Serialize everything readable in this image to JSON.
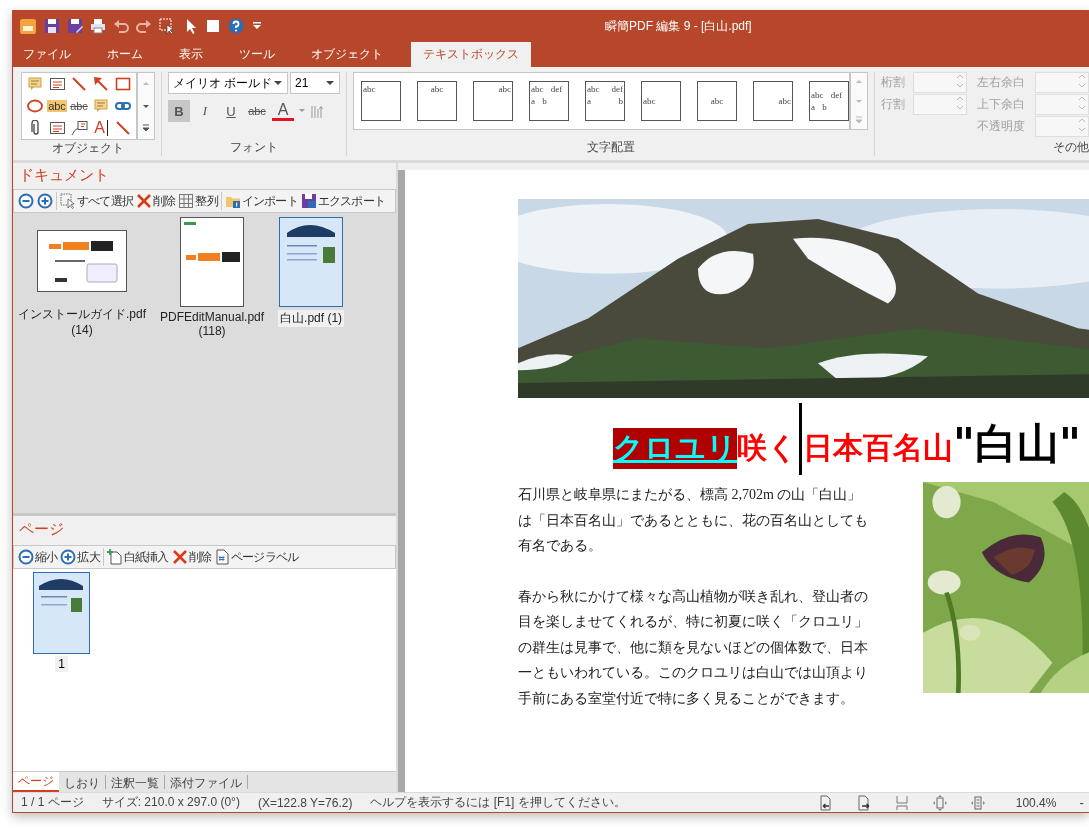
{
  "window": {
    "title": "瞬簡PDF 編集 9 - [白山.pdf]"
  },
  "tabs": [
    {
      "label": "ファイル",
      "selected": false
    },
    {
      "label": "ホーム",
      "selected": false
    },
    {
      "label": "表示",
      "selected": false
    },
    {
      "label": "ツール",
      "selected": false
    },
    {
      "label": "オブジェクト",
      "selected": false
    },
    {
      "label": "テキストボックス",
      "selected": true
    }
  ],
  "ribbon": {
    "object_group": {
      "label": "オブジェクト",
      "tools": [
        {
          "kind": "note"
        },
        {
          "kind": "textbox"
        },
        {
          "kind": "line"
        },
        {
          "kind": "arrow"
        },
        {
          "kind": "rect"
        },
        {
          "kind": "ellipse"
        },
        {
          "kind": "highlight",
          "label": "abc"
        },
        {
          "kind": "strikeout",
          "label": "abc"
        },
        {
          "kind": "note"
        },
        {
          "kind": "link"
        },
        {
          "kind": "clip"
        },
        {
          "kind": "textbox"
        },
        {
          "kind": "callout"
        },
        {
          "kind": "text",
          "label": "A"
        },
        {
          "kind": "line"
        }
      ]
    },
    "font_group": {
      "label": "フォント",
      "font_name": "メイリオ ボールド",
      "font_size": "21",
      "buttons": [
        {
          "kind": "bold",
          "label": "B",
          "selected": true
        },
        {
          "kind": "italic",
          "label": "I",
          "selected": false
        },
        {
          "kind": "underline",
          "label": "U",
          "selected": false
        },
        {
          "kind": "strike",
          "label": "abc",
          "selected": false
        },
        {
          "kind": "color",
          "label": "A",
          "color": "#e81123"
        }
      ]
    },
    "align_group": {
      "label": "文字配置",
      "items": [
        {
          "kind": "top-left",
          "lines": [
            "abc"
          ]
        },
        {
          "kind": "top-center",
          "lines": [
            "abc"
          ]
        },
        {
          "kind": "top-right",
          "lines": [
            "abc"
          ]
        },
        {
          "kind": "top-justify",
          "lines": [
            "abc def",
            "a b"
          ]
        },
        {
          "kind": "top-distribute",
          "lines": [
            "abc def",
            "a b"
          ]
        },
        {
          "kind": "middle-left",
          "lines": [
            "abc"
          ]
        },
        {
          "kind": "middle-center",
          "lines": [
            "abc"
          ]
        },
        {
          "kind": "middle-right",
          "lines": [
            "abc"
          ]
        },
        {
          "kind": "middle-justify",
          "lines": [
            "abc def",
            "a b"
          ]
        }
      ]
    },
    "other_group": {
      "label": "その他",
      "left_fields": [
        {
          "label": "桁割",
          "disabled": true
        },
        {
          "label": "行割",
          "disabled": true
        }
      ],
      "right_fields": [
        {
          "label": "左右余白",
          "disabled": true
        },
        {
          "label": "上下余白",
          "disabled": true
        },
        {
          "label": "不透明度",
          "disabled": true
        }
      ]
    }
  },
  "documents": {
    "title": "ドキュメント",
    "toolbar": [
      {
        "buttons": [
          {
            "kind": "zoom-out"
          },
          {
            "kind": "zoom-in"
          }
        ]
      },
      {
        "buttons": [
          {
            "kind": "select-all",
            "label": "すべて選択"
          },
          {
            "kind": "delete",
            "label": "削除"
          },
          {
            "kind": "arrange",
            "label": "整列"
          }
        ]
      },
      {
        "buttons": [
          {
            "kind": "import",
            "label": "インポート"
          },
          {
            "kind": "export",
            "label": "エクスポート"
          }
        ]
      }
    ],
    "files": [
      {
        "name": "インストールガイド.pdf",
        "count": "(14)",
        "kind": "landscape",
        "selected": false
      },
      {
        "name": "PDFEditManual.pdf",
        "count": "(118)",
        "kind": "portrait",
        "selected": false
      },
      {
        "name": "白山.pdf (1)",
        "selected": true
      }
    ]
  },
  "pages": {
    "title": "ページ",
    "toolbar": [
      {
        "buttons": [
          {
            "kind": "zoom-out",
            "label": "縮小"
          },
          {
            "kind": "zoom-in",
            "label": "拡大"
          }
        ]
      },
      {
        "buttons": [
          {
            "kind": "blank-page",
            "label": "白紙挿入"
          },
          {
            "kind": "delete",
            "label": "削除"
          },
          {
            "kind": "page-label",
            "label": "ページラベル"
          }
        ]
      }
    ],
    "items": [
      {
        "label": "1",
        "selected": true
      }
    ]
  },
  "panel_tabs": [
    {
      "label": "ページ",
      "selected": true
    },
    {
      "label": "しおり",
      "selected": false
    },
    {
      "label": "注釈一覧",
      "selected": false
    },
    {
      "label": "添付ファイル",
      "selected": false
    }
  ],
  "document": {
    "heading": [
      {
        "text": "クロユリ",
        "kind": "selected"
      },
      {
        "text": "咲く",
        "kind": "red"
      },
      {
        "text": "日本百名山",
        "kind": "red-caret"
      },
      {
        "text": "\"白山\"",
        "kind": "large"
      }
    ],
    "paragraphs": [
      "石川県と岐阜県にまたがる、標高 2,702m の山「白山」は「日本百名山」であるとともに、花の百名山としても有名である。",
      "春から秋にかけて様々な高山植物が咲き乱れ、登山者の目を楽しませてくれるが、特に初夏に咲く「クロユリ」の群生は見事で、他に類を見ないほどの個体数で、日本一ともいわれている。このクロユリは白山では山頂より手前にある室堂付近で特に多く見ることができます。"
    ]
  },
  "status_bar": {
    "page": "1 / 1 ページ",
    "size": "サイズ: 210.0 x 297.0 (0°)",
    "position": "(X=122.8 Y=76.2)",
    "help": "ヘルプを表示するには [F1] を押してください。",
    "zoom": "100.4%",
    "zoom_out": "-"
  }
}
